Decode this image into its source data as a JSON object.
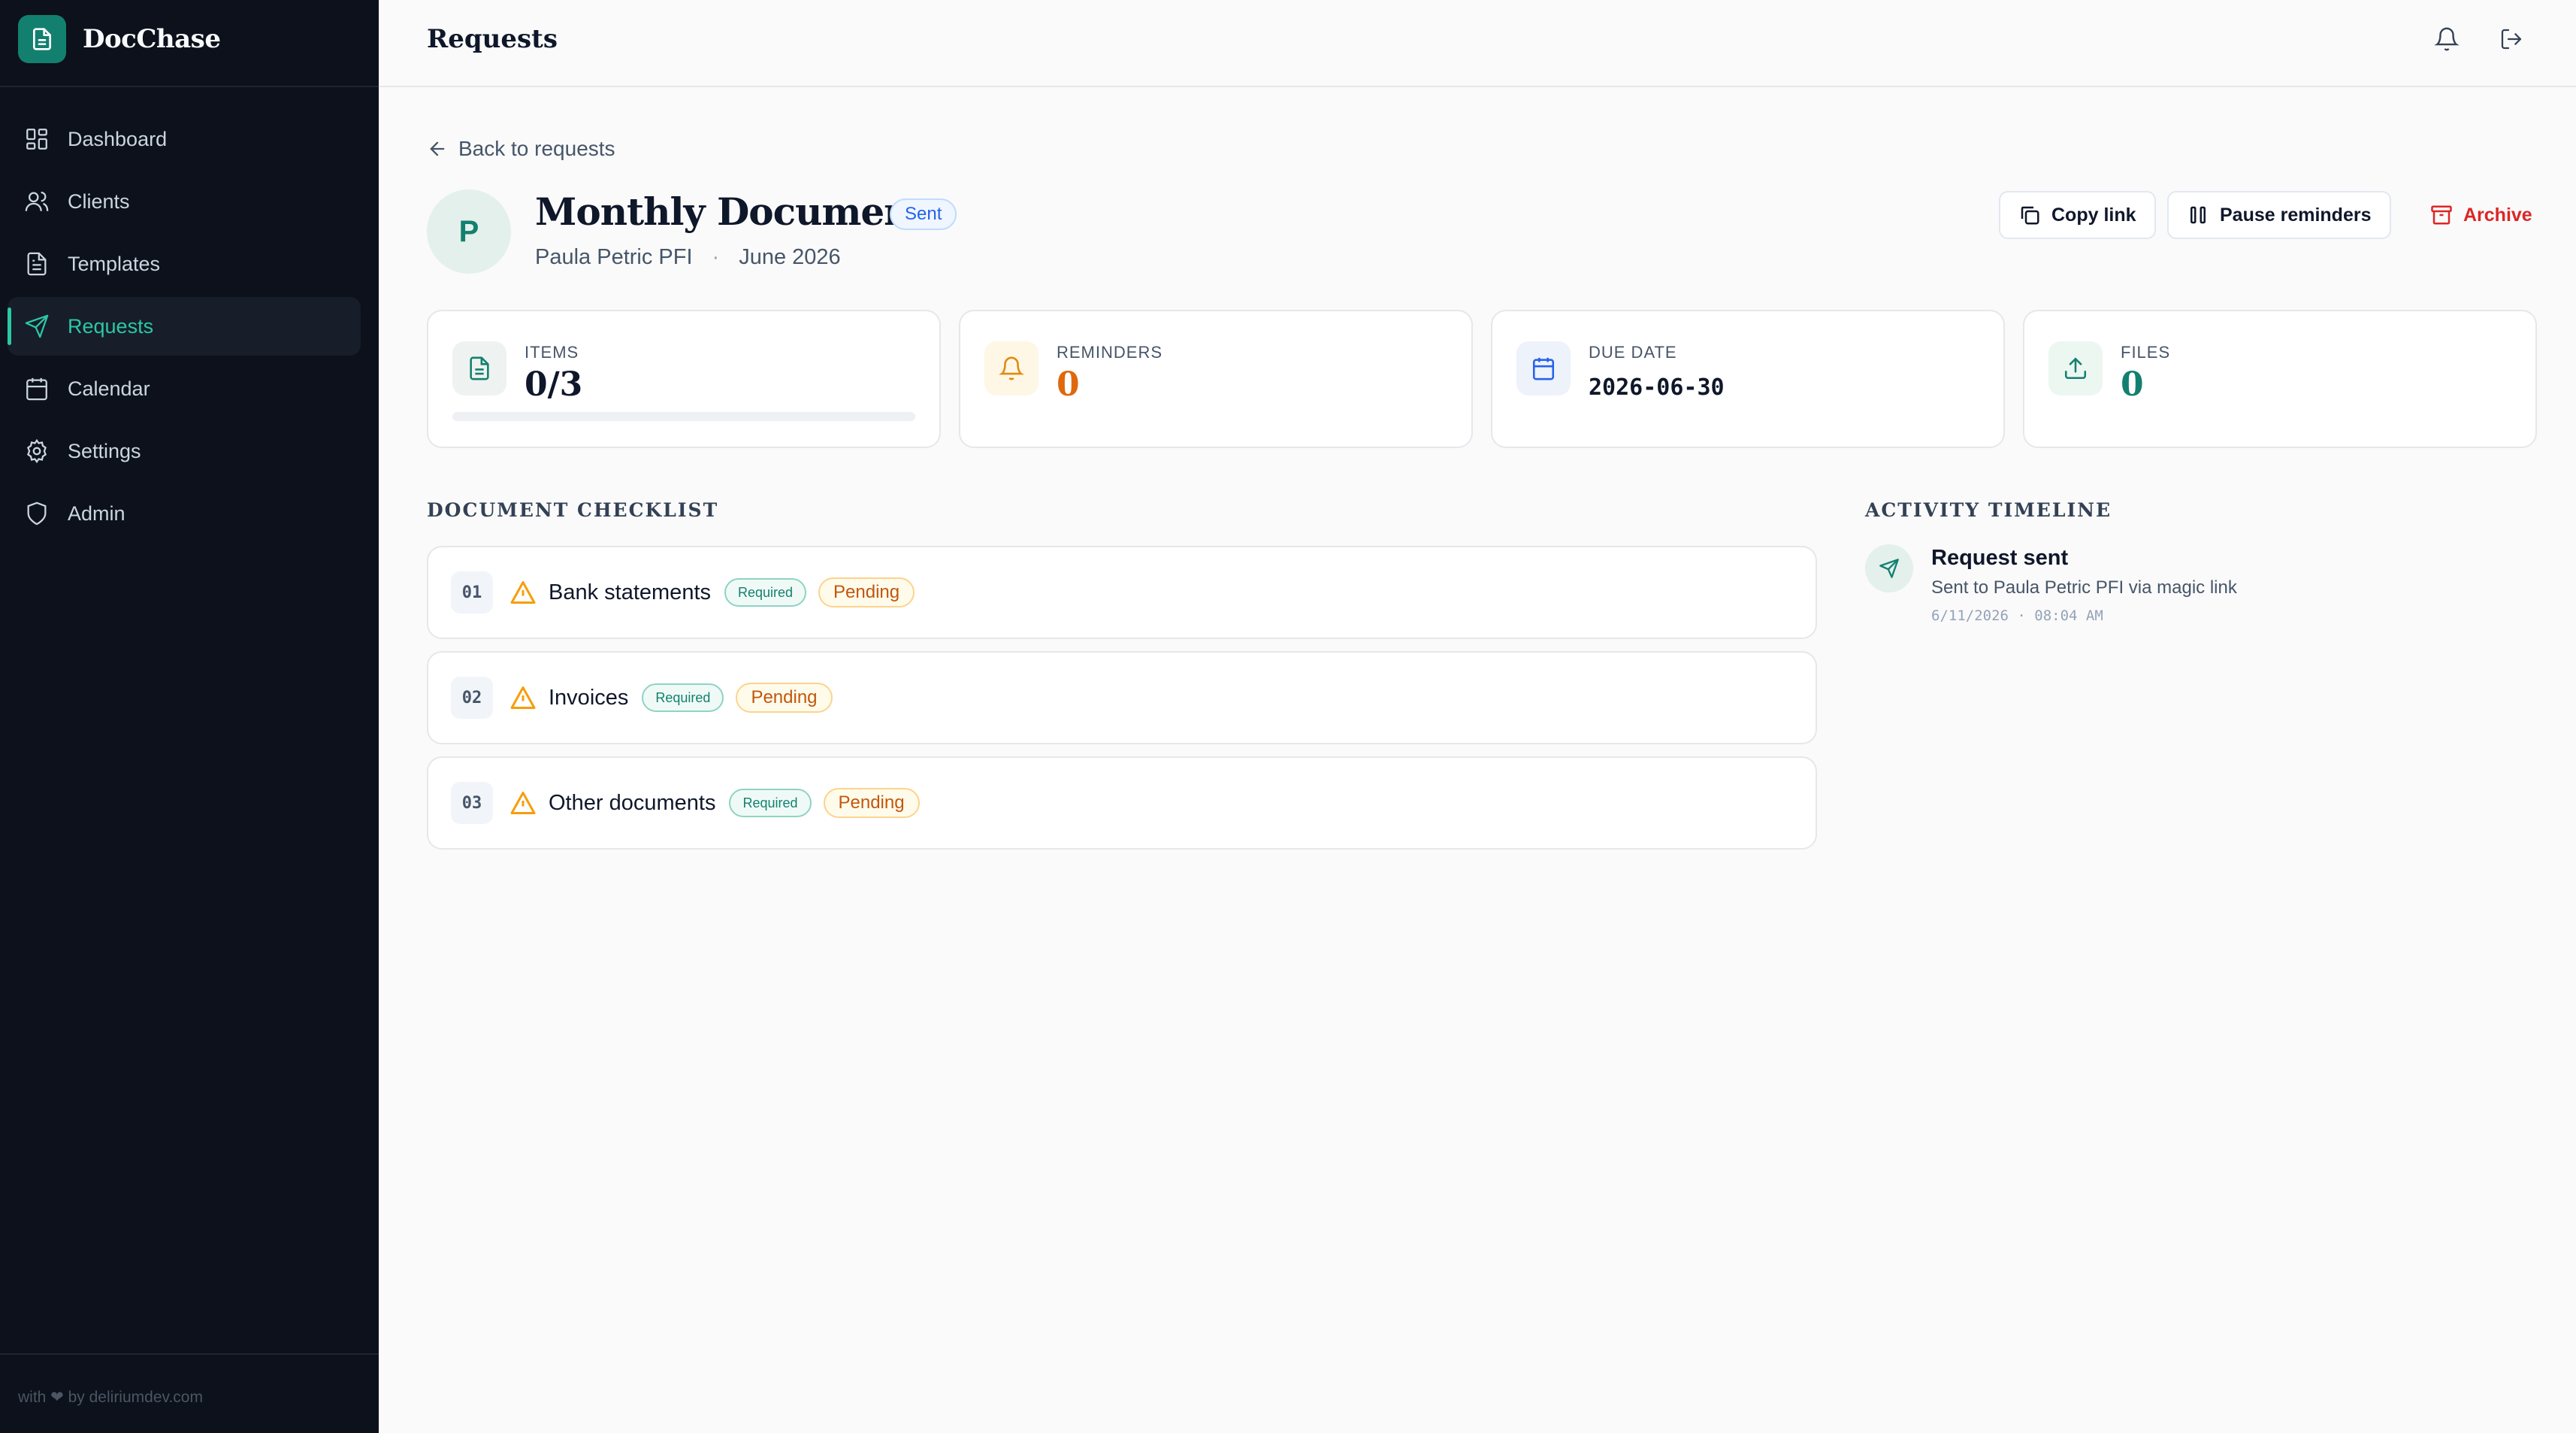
{
  "app": {
    "name": "DocChase",
    "footer": "with ❤ by deliriumdev.com"
  },
  "colors": {
    "accent": "#13806f",
    "sidebar_bg": "#0c111b",
    "danger": "#dc2626",
    "warning": "#f59e0b"
  },
  "sidebar": {
    "items": [
      {
        "label": "Dashboard",
        "icon": "dashboard-icon"
      },
      {
        "label": "Clients",
        "icon": "users-icon"
      },
      {
        "label": "Templates",
        "icon": "file-icon"
      },
      {
        "label": "Requests",
        "icon": "send-icon",
        "active": true
      },
      {
        "label": "Calendar",
        "icon": "calendar-icon"
      },
      {
        "label": "Settings",
        "icon": "gear-icon"
      },
      {
        "label": "Admin",
        "icon": "shield-icon"
      }
    ]
  },
  "header": {
    "title": "Requests"
  },
  "request": {
    "back_label": "Back to requests",
    "avatar_initial": "P",
    "title": "Monthly Documents",
    "status": "Sent",
    "client": "Paula Petric PFI",
    "separator": "·",
    "period": "June 2026",
    "actions": {
      "copy_link": "Copy link",
      "pause_reminders": "Pause reminders",
      "archive": "Archive"
    }
  },
  "stats": {
    "items": {
      "label": "ITEMS",
      "value": "0/3",
      "progress": 0
    },
    "reminders": {
      "label": "REMINDERS",
      "value": "0"
    },
    "due_date": {
      "label": "DUE DATE",
      "value": "2026-06-30"
    },
    "files": {
      "label": "FILES",
      "value": "0"
    }
  },
  "checklist": {
    "title": "DOCUMENT CHECKLIST",
    "items": [
      {
        "num": "01",
        "name": "Bank statements",
        "required": "Required",
        "status": "Pending"
      },
      {
        "num": "02",
        "name": "Invoices",
        "required": "Required",
        "status": "Pending"
      },
      {
        "num": "03",
        "name": "Other documents",
        "required": "Required",
        "status": "Pending"
      }
    ]
  },
  "timeline": {
    "title": "ACTIVITY TIMELINE",
    "events": [
      {
        "title": "Request sent",
        "description": "Sent to Paula Petric PFI via magic link",
        "time": "6/11/2026 · 08:04 AM"
      }
    ]
  }
}
